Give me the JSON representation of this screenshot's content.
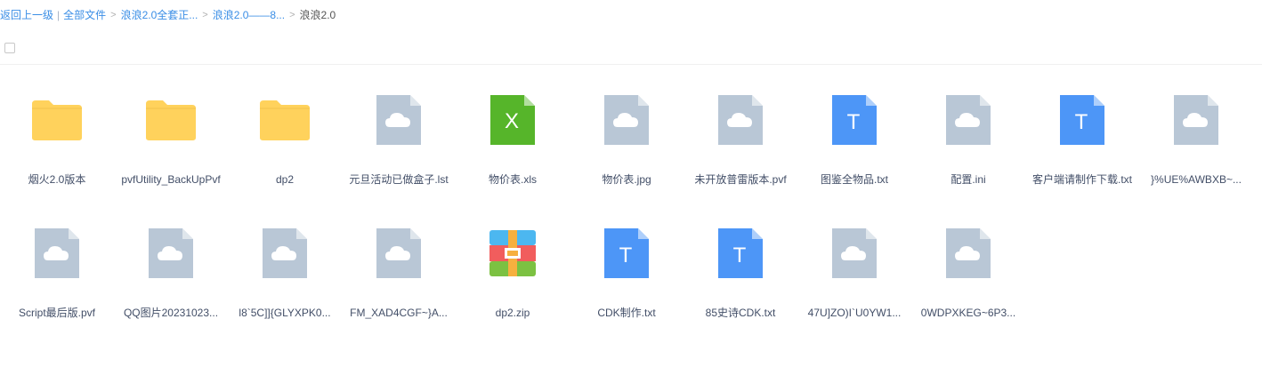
{
  "breadcrumb": {
    "back": "返回上一级",
    "all": "全部文件",
    "crumbs": [
      "浪浪2.0全套正...",
      "浪浪2.0——8..."
    ],
    "current": "浪浪2.0"
  },
  "files": [
    {
      "name": "烟火2.0版本",
      "type": "folder"
    },
    {
      "name": "pvfUtility_BackUpPvf",
      "type": "folder"
    },
    {
      "name": "dp2",
      "type": "folder"
    },
    {
      "name": "元旦活动已做盒子.lst",
      "type": "unknown"
    },
    {
      "name": "物价表.xls",
      "type": "excel"
    },
    {
      "name": "物价表.jpg",
      "type": "unknown"
    },
    {
      "name": "未开放普雷版本.pvf",
      "type": "unknown"
    },
    {
      "name": "图鉴全物品.txt",
      "type": "text"
    },
    {
      "name": "配置.ini",
      "type": "unknown"
    },
    {
      "name": "客户端请制作下载.txt",
      "type": "text"
    },
    {
      "name": "}%UE%AWBXB~...",
      "type": "unknown"
    },
    {
      "name": "Script最后版.pvf",
      "type": "unknown"
    },
    {
      "name": "QQ图片20231023...",
      "type": "unknown"
    },
    {
      "name": "l8`5C]]{GLYXPK0...",
      "type": "unknown"
    },
    {
      "name": "FM_XAD4CGF~}A...",
      "type": "unknown"
    },
    {
      "name": "dp2.zip",
      "type": "zip"
    },
    {
      "name": "CDK制作.txt",
      "type": "text"
    },
    {
      "name": "85史诗CDK.txt",
      "type": "text"
    },
    {
      "name": "47U]ZO)I`U0YW1...",
      "type": "unknown"
    },
    {
      "name": "0WDPXKEG~6P3...",
      "type": "unknown"
    }
  ],
  "colors": {
    "link": "#3a8ee6",
    "folder": "#ffd25c",
    "unknown_doc": "#b9c7d6",
    "text_doc": "#4d96f7",
    "excel_doc": "#56b52a"
  },
  "icons": {
    "folder": "folder-icon",
    "unknown": "unknown-file-icon",
    "text": "text-file-icon",
    "excel": "excel-file-icon",
    "zip": "zip-file-icon"
  }
}
